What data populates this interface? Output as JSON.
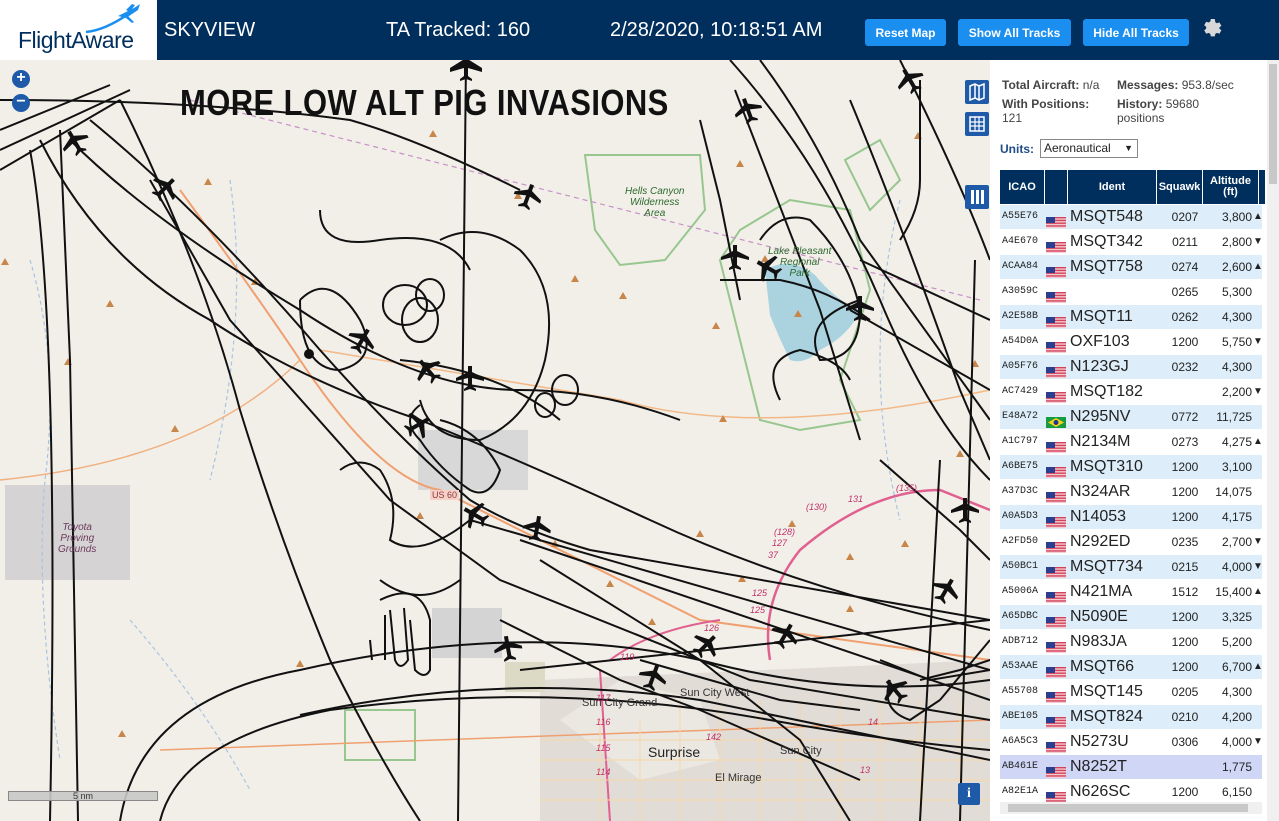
{
  "header": {
    "logo_text": "FlightAware",
    "app_name": "SKYVIEW",
    "ta_tracked": "TA Tracked: 160",
    "datetime": "2/28/2020, 10:18:51 AM",
    "buttons": {
      "reset_map": "Reset Map",
      "show_all_tracks": "Show All Tracks",
      "hide_all_tracks": "Hide All Tracks"
    },
    "settings_icon": "gear-icon"
  },
  "map": {
    "headline": "MORE LOW ALT PIG INVASIONS",
    "zoom_in": "+",
    "zoom_out": "−",
    "scale": "5 nm",
    "info": "i",
    "labels": {
      "hells_canyon": "Hells Canyon\nWilderness\nArea",
      "lake_pleasant": "Lake Pleasant\nRegional\nPark",
      "toyota": "Toyota\nProving\nGrounds",
      "sun_city_west": "Sun City West",
      "sun_city_grand": "Sun City Grand",
      "surprise": "Surprise",
      "sun_city": "Sun City",
      "el_mirage": "El Mirage",
      "us60": "US 60",
      "r131": "131",
      "r135": "(135)",
      "r130": "(130)",
      "r128": "(128)",
      "r127": "127",
      "r37": "37",
      "r125a": "125",
      "r125b": "125",
      "r126": "126",
      "r119": "119",
      "r117": "117",
      "r116": "116",
      "r115": "115",
      "r114": "114",
      "r142": "142",
      "r14": "14",
      "r13": "13"
    }
  },
  "panel": {
    "total_aircraft_label": "Total Aircraft:",
    "total_aircraft": "n/a",
    "messages_label": "Messages:",
    "messages": "953.8/sec",
    "with_positions_label": "With Positions:",
    "with_positions": "121",
    "history_label": "History:",
    "history": "59680",
    "history_unit": "positions",
    "units_label": "Units:",
    "units_value": "Aeronautical",
    "columns": [
      "ICAO",
      "Ident",
      "Squawk",
      "Altitude (ft)"
    ],
    "rows": [
      {
        "icao": "A55E76",
        "flag": "us",
        "ident": "MSQT548",
        "squawk": "0207",
        "alt": "3,800",
        "trend": "▲"
      },
      {
        "icao": "A4E670",
        "flag": "us",
        "ident": "MSQT342",
        "squawk": "0211",
        "alt": "2,800",
        "trend": "▼"
      },
      {
        "icao": "ACAA84",
        "flag": "us",
        "ident": "MSQT758",
        "squawk": "0274",
        "alt": "2,600",
        "trend": "▲"
      },
      {
        "icao": "A3059C",
        "flag": "us",
        "ident": "",
        "squawk": "0265",
        "alt": "5,300",
        "trend": ""
      },
      {
        "icao": "A2E58B",
        "flag": "us",
        "ident": "MSQT11",
        "squawk": "0262",
        "alt": "4,300",
        "trend": ""
      },
      {
        "icao": "A54D0A",
        "flag": "us",
        "ident": "OXF103",
        "squawk": "1200",
        "alt": "5,750",
        "trend": "▼"
      },
      {
        "icao": "A05F76",
        "flag": "us",
        "ident": "N123GJ",
        "squawk": "0232",
        "alt": "4,300",
        "trend": ""
      },
      {
        "icao": "AC7429",
        "flag": "us",
        "ident": "MSQT182",
        "squawk": "",
        "alt": "2,200",
        "trend": "▼"
      },
      {
        "icao": "E48A72",
        "flag": "br",
        "ident": "N295NV",
        "squawk": "0772",
        "alt": "11,725",
        "trend": ""
      },
      {
        "icao": "A1C797",
        "flag": "us",
        "ident": "N2134M",
        "squawk": "0273",
        "alt": "4,275",
        "trend": "▲"
      },
      {
        "icao": "A6BE75",
        "flag": "us",
        "ident": "MSQT310",
        "squawk": "1200",
        "alt": "3,100",
        "trend": ""
      },
      {
        "icao": "A37D3C",
        "flag": "us",
        "ident": "N324AR",
        "squawk": "1200",
        "alt": "14,075",
        "trend": ""
      },
      {
        "icao": "A0A5D3",
        "flag": "us",
        "ident": "N14053",
        "squawk": "1200",
        "alt": "4,175",
        "trend": ""
      },
      {
        "icao": "A2FD50",
        "flag": "us",
        "ident": "N292ED",
        "squawk": "0235",
        "alt": "2,700",
        "trend": "▼"
      },
      {
        "icao": "A50BC1",
        "flag": "us",
        "ident": "MSQT734",
        "squawk": "0215",
        "alt": "4,000",
        "trend": "▼"
      },
      {
        "icao": "A5006A",
        "flag": "us",
        "ident": "N421MA",
        "squawk": "1512",
        "alt": "15,400",
        "trend": "▲"
      },
      {
        "icao": "A65DBC",
        "flag": "us",
        "ident": "N5090E",
        "squawk": "1200",
        "alt": "3,325",
        "trend": ""
      },
      {
        "icao": "ADB712",
        "flag": "us",
        "ident": "N983JA",
        "squawk": "1200",
        "alt": "5,200",
        "trend": ""
      },
      {
        "icao": "A53AAE",
        "flag": "us",
        "ident": "MSQT66",
        "squawk": "1200",
        "alt": "6,700",
        "trend": "▲"
      },
      {
        "icao": "A55708",
        "flag": "us",
        "ident": "MSQT145",
        "squawk": "0205",
        "alt": "4,300",
        "trend": ""
      },
      {
        "icao": "ABE105",
        "flag": "us",
        "ident": "MSQT824",
        "squawk": "0210",
        "alt": "4,200",
        "trend": ""
      },
      {
        "icao": "A6A5C3",
        "flag": "us",
        "ident": "N5273U",
        "squawk": "0306",
        "alt": "4,000",
        "trend": "▼"
      },
      {
        "icao": "AB461E",
        "flag": "us",
        "ident": "N8252T",
        "squawk": "",
        "alt": "1,775",
        "trend": "",
        "selected": true
      },
      {
        "icao": "A82E1A",
        "flag": "us",
        "ident": "N626SC",
        "squawk": "1200",
        "alt": "6,150",
        "trend": ""
      }
    ]
  },
  "colors": {
    "header_bg": "#002f5d",
    "button_bg": "#1a8ff0",
    "row_tint": "#ddeefa",
    "row_selected": "#cfd6f6",
    "map_bg": "#f2efe9"
  }
}
